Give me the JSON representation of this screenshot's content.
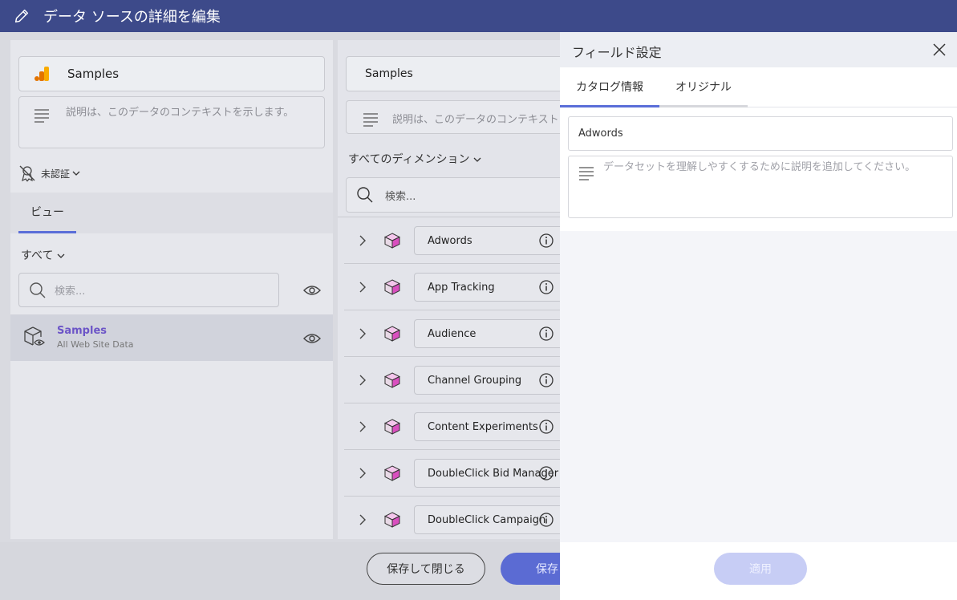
{
  "titlebar": {
    "title": "データ ソースの詳細を編集"
  },
  "left": {
    "source_name": "Samples",
    "desc_placeholder": "説明は、このデータのコンテキストを示します。",
    "cert_label": "未認証",
    "tab_view": "ビュー",
    "filter_all": "すべて",
    "search_placeholder": "検索...",
    "item": {
      "title": "Samples",
      "subtitle": "All Web Site Data"
    }
  },
  "middle": {
    "name": "Samples",
    "desc_placeholder": "説明は、このデータのコンテキスト",
    "dim_all": "すべてのディメンション",
    "search_placeholder": "検索...",
    "dimensions": [
      "Adwords",
      "App Tracking",
      "Audience",
      "Channel Grouping",
      "Content Experiments",
      "DoubleClick Bid Manager",
      "DoubleClick Campaign"
    ]
  },
  "bottom": {
    "save_close": "保存して閉じる",
    "save": "保存"
  },
  "drawer": {
    "title": "フィールド設定",
    "tab_catalog": "カタログ情報",
    "tab_original": "オリジナル",
    "name_value": "Adwords",
    "desc_placeholder": "データセットを理解しやすくするために説明を追加してください。",
    "apply": "適用"
  },
  "colors": {
    "titlebar": "#3d4a8a",
    "accent": "#5a6ed8",
    "cube": "#d94fbf",
    "purple_text": "#6c55c7"
  }
}
